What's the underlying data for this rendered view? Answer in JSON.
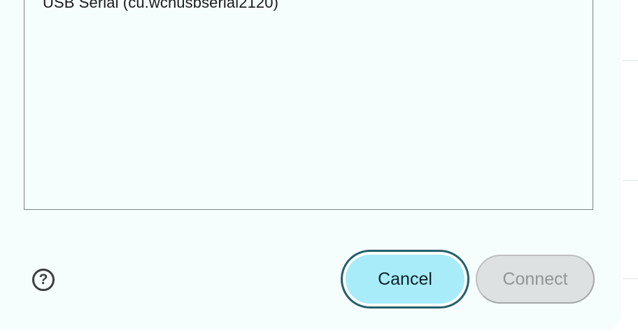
{
  "dialog": {
    "ports": [
      {
        "label": "USB Serial (cu.wchusbserial2120)"
      }
    ],
    "help_icon": {
      "name": "help-icon",
      "glyph": "?"
    },
    "cancel_label": "Cancel",
    "connect_label": "Connect",
    "connect_disabled": true
  },
  "colors": {
    "dialog_bg": "#f6fdfd",
    "cancel_bg": "#a8ecfa",
    "cancel_border": "#24606b",
    "connect_bg": "#dde1e1",
    "connect_text": "#8f9595"
  }
}
